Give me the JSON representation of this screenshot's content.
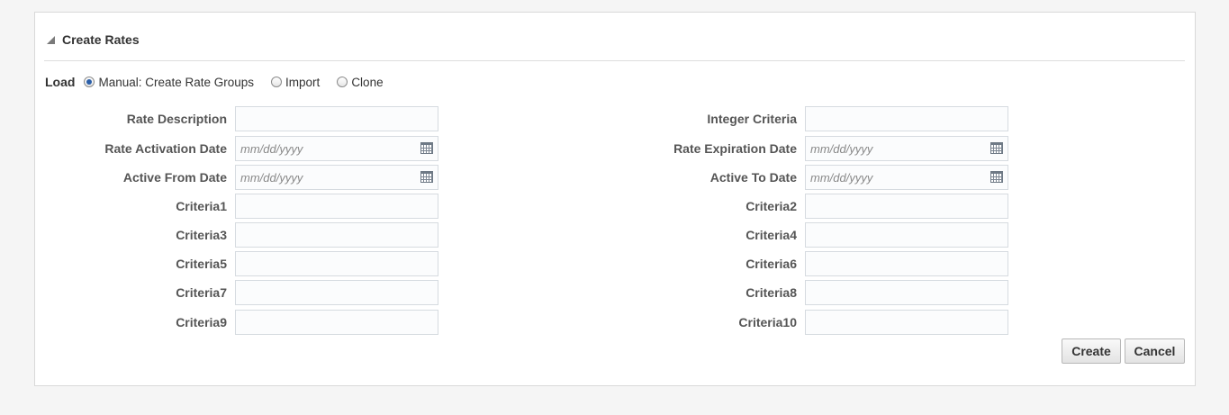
{
  "panel": {
    "title": "Create Rates",
    "disclosure_icon": "collapse-triangle-icon"
  },
  "load": {
    "label": "Load",
    "options": [
      {
        "label": "Manual: Create Rate Groups",
        "checked": true
      },
      {
        "label": "Import",
        "checked": false
      },
      {
        "label": "Clone",
        "checked": false
      }
    ]
  },
  "form": {
    "left": [
      {
        "label": "Rate Description",
        "value": "",
        "placeholder": ""
      },
      {
        "label": "Rate Activation Date",
        "value": "",
        "placeholder": "mm/dd/yyyy"
      },
      {
        "label": "Active From Date",
        "value": "",
        "placeholder": "mm/dd/yyyy"
      },
      {
        "label": "Criteria1",
        "value": "",
        "placeholder": ""
      },
      {
        "label": "Criteria3",
        "value": "",
        "placeholder": ""
      },
      {
        "label": "Criteria5",
        "value": "",
        "placeholder": ""
      },
      {
        "label": "Criteria7",
        "value": "",
        "placeholder": ""
      },
      {
        "label": "Criteria9",
        "value": "",
        "placeholder": ""
      }
    ],
    "right": [
      {
        "label": "Integer Criteria",
        "value": "",
        "placeholder": ""
      },
      {
        "label": "Rate Expiration Date",
        "value": "",
        "placeholder": "mm/dd/yyyy"
      },
      {
        "label": "Active To Date",
        "value": "",
        "placeholder": "mm/dd/yyyy"
      },
      {
        "label": "Criteria2",
        "value": "",
        "placeholder": ""
      },
      {
        "label": "Criteria4",
        "value": "",
        "placeholder": ""
      },
      {
        "label": "Criteria6",
        "value": "",
        "placeholder": ""
      },
      {
        "label": "Criteria8",
        "value": "",
        "placeholder": ""
      },
      {
        "label": "Criteria10",
        "value": "",
        "placeholder": ""
      }
    ]
  },
  "buttons": {
    "create": "Create",
    "cancel": "Cancel"
  },
  "icons": {
    "date_picker": "calendar-icon"
  },
  "colors": {
    "background": "#f5f5f5",
    "panel": "#ffffff",
    "label": "#555555",
    "input_border": "#d6dbe0"
  }
}
